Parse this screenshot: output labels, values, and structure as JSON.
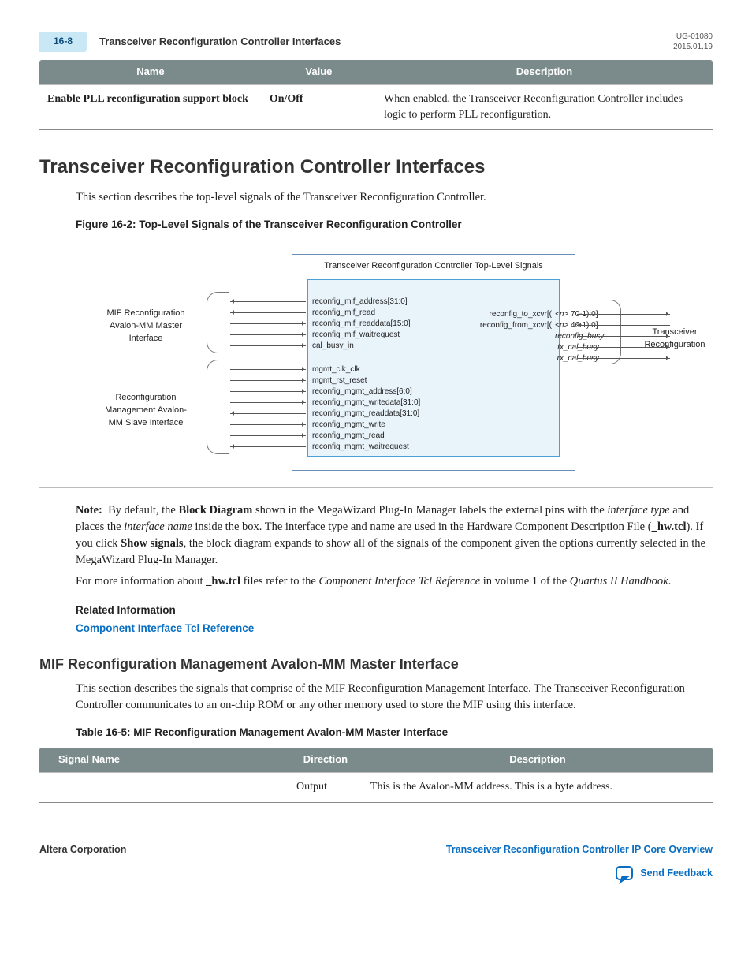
{
  "header": {
    "page_num": "16-8",
    "title": "Transceiver Reconfiguration Controller Interfaces",
    "doc_id": "UG-01080",
    "date": "2015.01.19"
  },
  "table1": {
    "headers": [
      "Name",
      "Value",
      "Description"
    ],
    "row": {
      "name": "Enable PLL reconfiguration support block",
      "value": "On/Off",
      "desc": "When enabled, the Transceiver Reconfiguration Controller includes logic to perform PLL reconfiguration."
    }
  },
  "section1": {
    "heading": "Transceiver Reconfiguration Controller Interfaces",
    "intro": "This section describes the top-level signals of the Transceiver Reconfiguration Controller.",
    "figcap": "Figure 16-2: Top-Level Signals of the Transceiver Reconfiguration Controller"
  },
  "diagram": {
    "title": "Transceiver Reconfiguration Controller Top-Level Signals",
    "left_label_top": "MIF Reconfiguration Avalon-MM Master Interface",
    "left_label_bot": "Reconfiguration Management Avalon-MM Slave Interface",
    "right_label": "Transceiver Reconfiguration",
    "mif_signals": [
      "reconfig_mif_address[31:0]",
      "reconfig_mif_read",
      "reconfig_mif_readdata[15:0]",
      "reconfig_mif_waitrequest",
      "cal_busy_in"
    ],
    "mif_dirs": [
      "out",
      "out",
      "in",
      "in",
      "in"
    ],
    "mgmt_signals": [
      "mgmt_clk_clk",
      "mgmt_rst_reset",
      "reconfig_mgmt_address[6:0]",
      "reconfig_mgmt_writedata[31:0]",
      "reconfig_mgmt_readdata[31:0]",
      "reconfig_mgmt_write",
      "reconfig_mgmt_read",
      "reconfig_mgmt_waitrequest"
    ],
    "mgmt_dirs": [
      "in",
      "in",
      "in",
      "in",
      "out",
      "in",
      "in",
      "out"
    ],
    "xcvr_left": [
      "reconfig_to_xcvr[(",
      "reconfig_from_xcvr[("
    ],
    "xcvr_right_n": [
      "<n>",
      "<n>"
    ],
    "xcvr_right_rest": [
      " 70-1):0]",
      " 46-1):0]"
    ],
    "xcvr_lower": [
      "reconfig_busy",
      "tx_cal_busy",
      "rx_cal_busy"
    ],
    "xcvr_dirs": [
      "out",
      "in",
      "out",
      "out",
      "out"
    ]
  },
  "note": {
    "label": "Note:",
    "body_pre": "By default, the ",
    "bold1": "Block Diagram",
    "body_mid1": " shown in the MegaWizard Plug-In Manager labels the external pins with the ",
    "ital1": "interface type",
    "body_mid2": " and places the ",
    "ital2": "interface name",
    "body_mid3": " inside the box. The interface type and name are used in the Hardware Component Description File (",
    "bold2": "_hw.tcl",
    "body_mid4": "). If you click ",
    "bold3": "Show signals",
    "body_end": ", the block diagram expands to show all of the signals of the component given the options currently selected in the MegaWizard Plug-In Manager."
  },
  "para2_pre": "For more information about ",
  "para2_b": "_hw.tcl",
  "para2_mid": " files refer to the ",
  "para2_i": "Component Interface Tcl Reference",
  "para2_mid2": " in volume 1 of the ",
  "para2_i2": "Quartus II Handbook",
  "para2_end": ".",
  "related_info": {
    "heading": "Related Information",
    "link": "Component Interface Tcl Reference"
  },
  "section2": {
    "heading": "MIF Reconfiguration Management Avalon-MM Master Interface",
    "intro": "This section describes the signals that comprise of the MIF Reconfiguration Management Interface. The Transceiver Reconfiguration Controller communicates to an on-chip ROM or any other memory used to store the MIF using this interface.",
    "tabcap": "Table 16-5: MIF Reconfiguration Management Avalon-MM Master Interface"
  },
  "table2": {
    "headers": [
      "Signal Name",
      "Direction",
      "Description"
    ],
    "row": {
      "name": "",
      "dir": "Output",
      "desc": "This is the Avalon-MM address. This is a byte address."
    }
  },
  "footer": {
    "left": "Altera Corporation",
    "right": "Transceiver Reconfiguration Controller IP Core Overview",
    "feedback": "Send Feedback"
  }
}
